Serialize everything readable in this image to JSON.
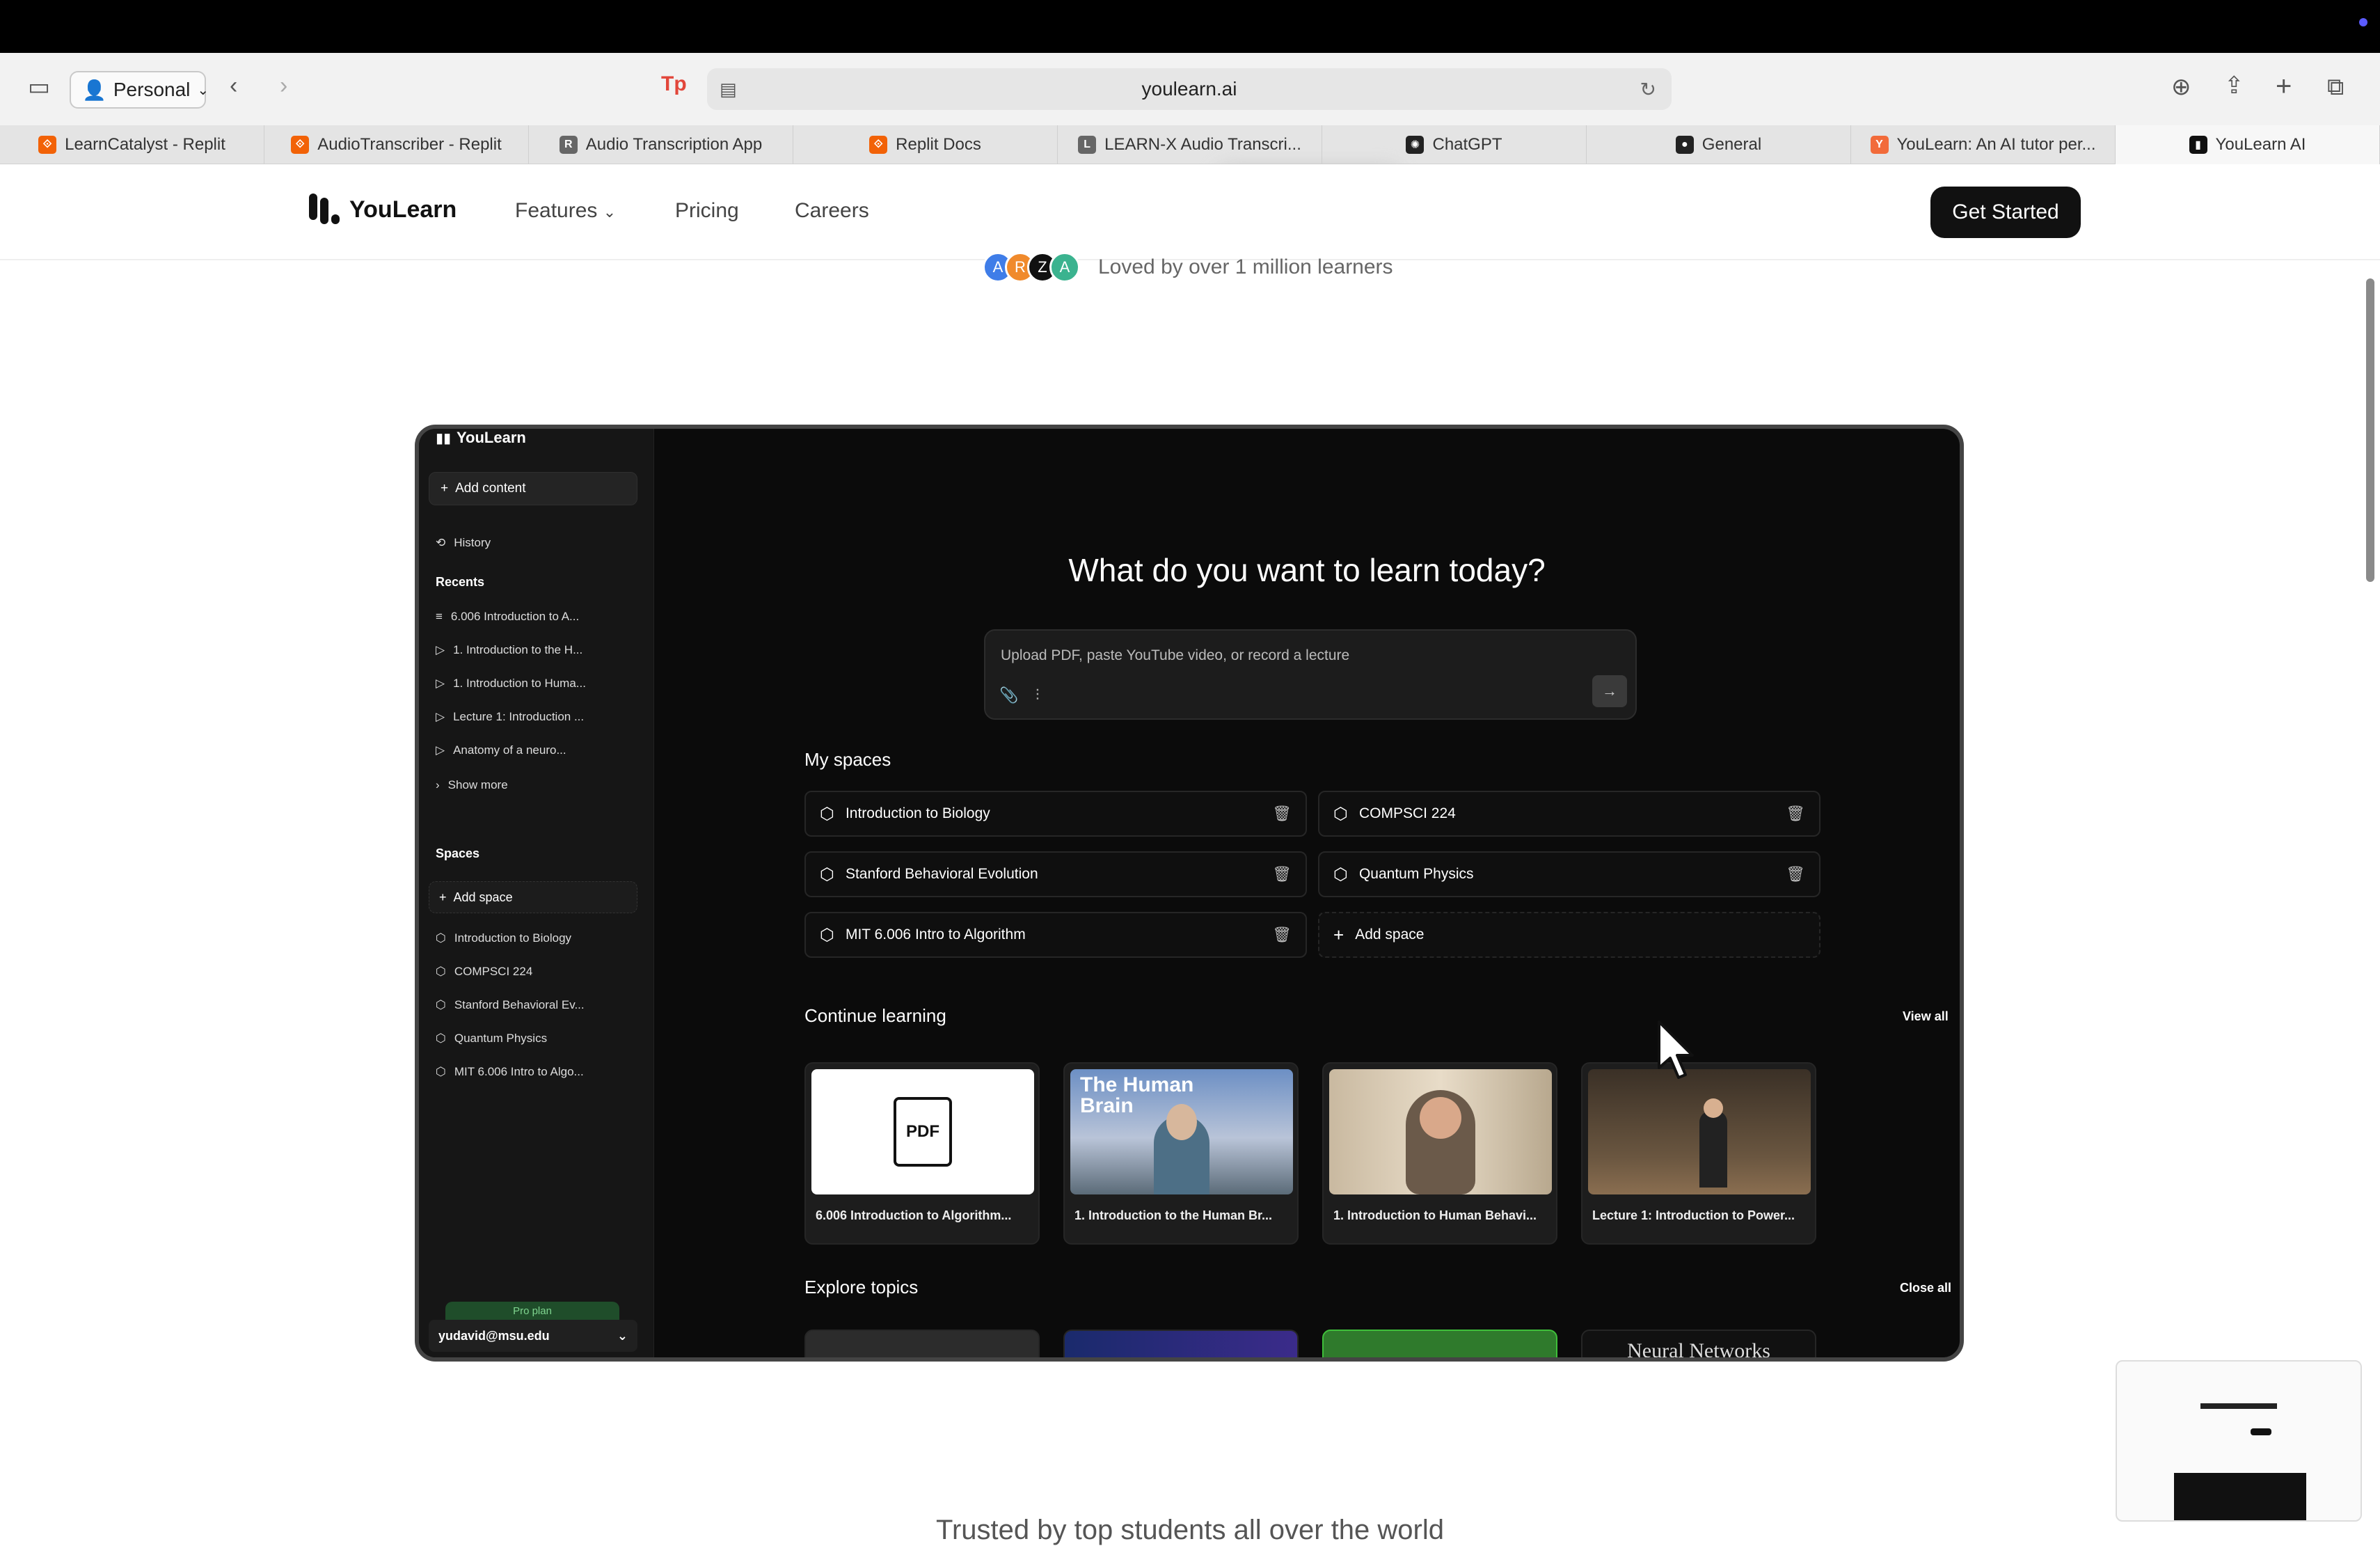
{
  "browser": {
    "profile": "Personal",
    "url": "youlearn.ai",
    "tabs": [
      {
        "label": "LearnCatalyst - Replit",
        "fav_color": "#f26207",
        "fav": "⟐"
      },
      {
        "label": "AudioTranscriber - Replit",
        "fav_color": "#f26207",
        "fav": "⟐"
      },
      {
        "label": "Audio Transcription App",
        "fav_color": "#666666",
        "fav": "R"
      },
      {
        "label": "Replit Docs",
        "fav_color": "#f26207",
        "fav": "⟐"
      },
      {
        "label": "LEARN-X Audio Transcri...",
        "fav_color": "#666666",
        "fav": "L"
      },
      {
        "label": "ChatGPT",
        "fav_color": "#222222",
        "fav": "✺"
      },
      {
        "label": "General",
        "fav_color": "#222222",
        "fav": "●"
      },
      {
        "label": "YouLearn: An AI tutor per...",
        "fav_color": "#f26b3a",
        "fav": "Y"
      },
      {
        "label": "YouLearn AI",
        "fav_color": "#111111",
        "fav": "▮"
      }
    ]
  },
  "site": {
    "brand": "YouLearn",
    "nav": {
      "features": "Features",
      "pricing": "Pricing",
      "careers": "Careers"
    },
    "cta": "Get Started",
    "loved": "Loved by over 1 million learners",
    "avatars": [
      "A",
      "R",
      "Z",
      "A"
    ],
    "trusted": "Trusted by top students all over the world"
  },
  "app": {
    "brand": "YouLearn",
    "add_content": "Add content",
    "history": "History",
    "recents_label": "Recents",
    "recents": [
      {
        "label": "6.006 Introduction to A...",
        "icon": "≡"
      },
      {
        "label": "1. Introduction to the H...",
        "icon": "▷"
      },
      {
        "label": "1. Introduction to Huma...",
        "icon": "▷"
      },
      {
        "label": "Lecture 1: Introduction ...",
        "icon": "▷"
      },
      {
        "label": "Anatomy of a neuro...",
        "icon": "▷"
      }
    ],
    "show_more": "Show more",
    "spaces_label": "Spaces",
    "add_space": "Add space",
    "sidebar_spaces": [
      "Introduction to Biology",
      "COMPSCI 224",
      "Stanford Behavioral Ev...",
      "Quantum Physics",
      "MIT 6.006 Intro to Algo..."
    ],
    "pro_plan": "Pro plan",
    "user_email": "yudavid@msu.edu",
    "main_title": "What do you want to learn today?",
    "upload_placeholder": "Upload PDF, paste YouTube video, or record a lecture",
    "my_spaces_label": "My spaces",
    "my_spaces": [
      "Introduction to Biology",
      "COMPSCI 224",
      "Stanford Behavioral Evolution",
      "Quantum Physics",
      "MIT 6.006 Intro to Algorithm"
    ],
    "add_space_card": "Add space",
    "continue_label": "Continue learning",
    "view_all": "View all",
    "continue_items": [
      "6.006 Introduction to Algorithm...",
      "1. Introduction to the Human Br...",
      "1. Introduction to Human Behavi...",
      "Lecture 1: Introduction to Power..."
    ],
    "thumb_brain_text": "The Human Brain",
    "thumb_pdf_text": "PDF",
    "explore_label": "Explore topics",
    "close_all": "Close all",
    "explore_last": "Neural Networks"
  }
}
